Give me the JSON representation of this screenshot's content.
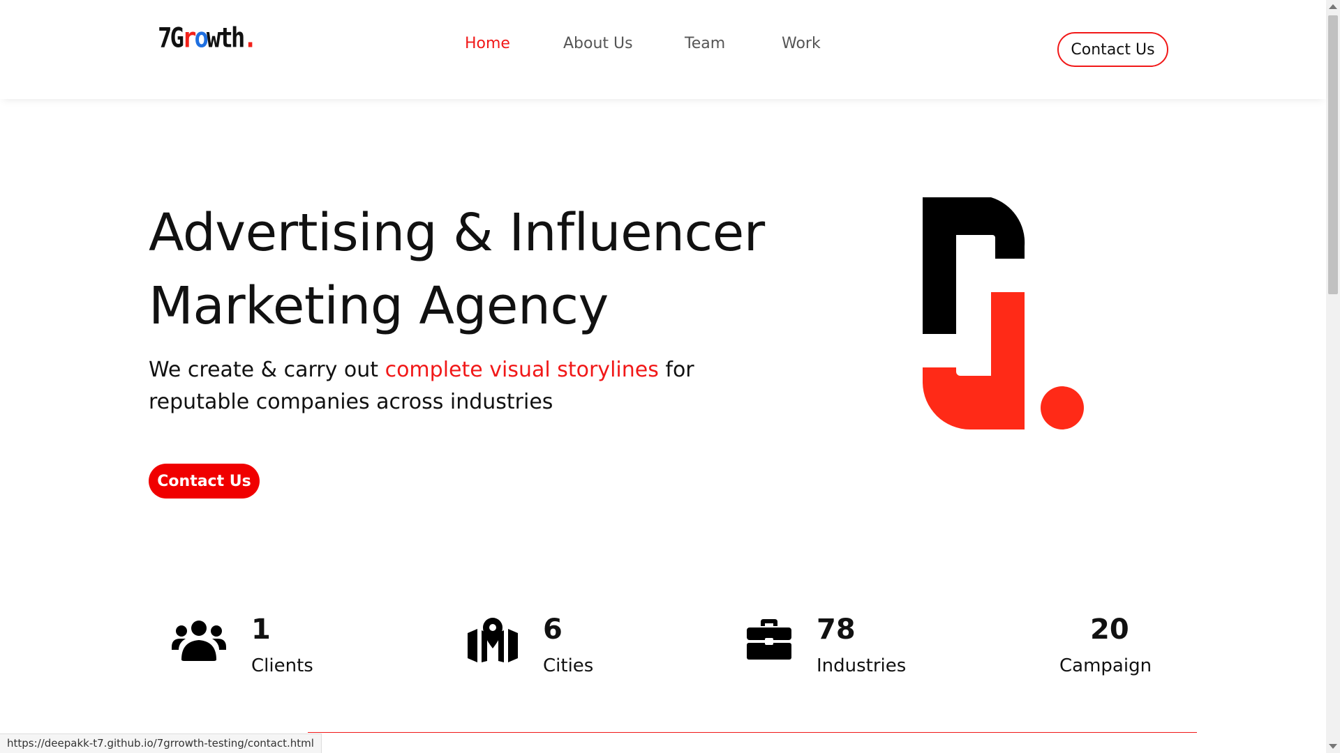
{
  "brand": {
    "logo_start": "7G",
    "logo_r": "r",
    "logo_o": "o",
    "logo_end": "wth",
    "logo_dot": "."
  },
  "nav": {
    "items": [
      {
        "label": "Home",
        "active": true
      },
      {
        "label": "About Us",
        "active": false
      },
      {
        "label": "Team",
        "active": false
      },
      {
        "label": "Work",
        "active": false
      }
    ],
    "contact_label": "Contact Us"
  },
  "hero": {
    "title_line1": "Advertising & Influencer",
    "title_line2": "Marketing Agency",
    "subtitle_before": "We create & carry out ",
    "subtitle_highlight": "complete visual storylines",
    "subtitle_after": " for reputable companies across industries",
    "cta_label": "Contact Us"
  },
  "stats": [
    {
      "value": "1",
      "label": "Clients",
      "icon": "users-icon"
    },
    {
      "value": "6",
      "label": "Cities",
      "icon": "map-icon"
    },
    {
      "value": "78",
      "label": "Industries",
      "icon": "briefcase-icon"
    },
    {
      "value": "20",
      "label": "Campaign",
      "icon": ""
    }
  ],
  "status_url": "https://deepakk-t7.github.io/7grrowth-testing/contact.html",
  "colors": {
    "accent": "#f11818",
    "text": "#111111",
    "nav_text": "#555555",
    "logo_blue": "#1f6fe0",
    "mark_red": "#ff2a17"
  }
}
